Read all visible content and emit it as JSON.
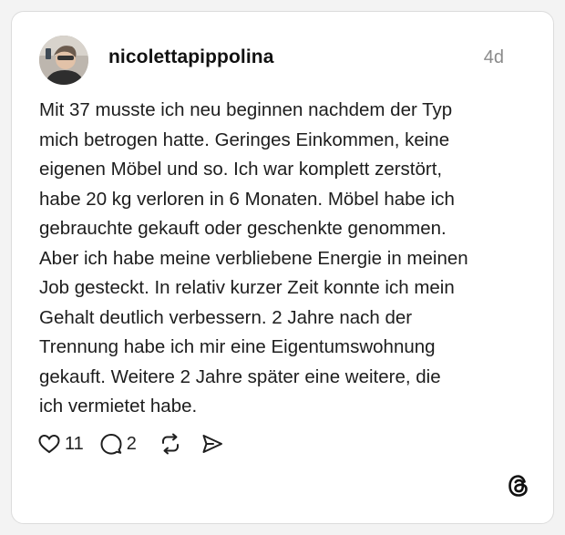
{
  "post": {
    "username": "nicolettapippolina",
    "timestamp": "4d",
    "text": "Mit 37 musste ich neu beginnen nachdem der Typ\nmich betrogen hatte. Geringes Einkommen, keine\neigenen Möbel und so. Ich war komplett zerstört,\nhabe 20 kg verloren in 6 Monaten. Möbel habe ich\ngebrauchte gekauft oder geschenkte genommen.\nAber ich habe meine verbliebene Energie in meinen\nJob gesteckt. In relativ kurzer Zeit konnte ich mein\nGehalt deutlich verbessern. 2 Jahre nach der\nTrennung habe ich mir eine Eigentumswohnung\ngekauft. Weitere 2 Jahre später eine weitere, die\nich vermietet habe.",
    "likes": "11",
    "replies": "2"
  },
  "icons": {
    "like": "heart-icon",
    "reply": "comment-icon",
    "repost": "repost-icon",
    "share": "send-icon",
    "brand": "threads-logo-icon"
  },
  "colors": {
    "background": "#f3f3f3",
    "card": "#ffffff",
    "text": "#1d1d1d",
    "muted": "#8a8a8a"
  }
}
